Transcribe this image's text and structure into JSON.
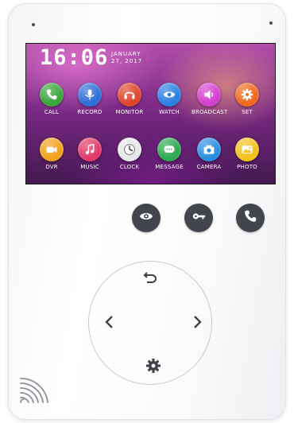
{
  "clock": {
    "time": "16:06",
    "month": "JANUARY",
    "day_year": "27, 2017"
  },
  "apps_row1": [
    {
      "label": "CALL",
      "icon": "phone-icon",
      "color": "#3aa63c"
    },
    {
      "label": "RECORD",
      "icon": "microphone-icon",
      "color": "#2f6fd8"
    },
    {
      "label": "MONITOR",
      "icon": "headphones-icon",
      "color": "#e0452c"
    },
    {
      "label": "WATCH",
      "icon": "eye-icon",
      "color": "#2a7fe0"
    },
    {
      "label": "BROADCAST",
      "icon": "speaker-icon",
      "color": "#d53fcf"
    },
    {
      "label": "SET",
      "icon": "gear-icon",
      "color": "#f06a1e"
    }
  ],
  "apps_row2": [
    {
      "label": "DVR",
      "icon": "video-camera-icon",
      "color": "#f0a21e"
    },
    {
      "label": "MUSIC",
      "icon": "music-note-icon",
      "color": "#e23a6a"
    },
    {
      "label": "CLOCK",
      "icon": "clock-icon",
      "color": "#e8e8ea"
    },
    {
      "label": "MESSAGE",
      "icon": "message-icon",
      "color": "#2faa52"
    },
    {
      "label": "CAMERA",
      "icon": "camera-icon",
      "color": "#2b8ee0"
    },
    {
      "label": "PHOTO",
      "icon": "photo-icon",
      "color": "#f2c21e"
    }
  ],
  "hardware_buttons": [
    {
      "name": "monitor-button",
      "icon": "eye-icon"
    },
    {
      "name": "unlock-button",
      "icon": "key-icon"
    },
    {
      "name": "talk-button",
      "icon": "phone-icon"
    }
  ],
  "dpad": {
    "up": "back-arrow-icon",
    "left": "chevron-left-icon",
    "right": "chevron-right-icon",
    "down": "gear-icon"
  },
  "colors": {
    "button_dark": "#42454c",
    "body": "#ffffff"
  }
}
